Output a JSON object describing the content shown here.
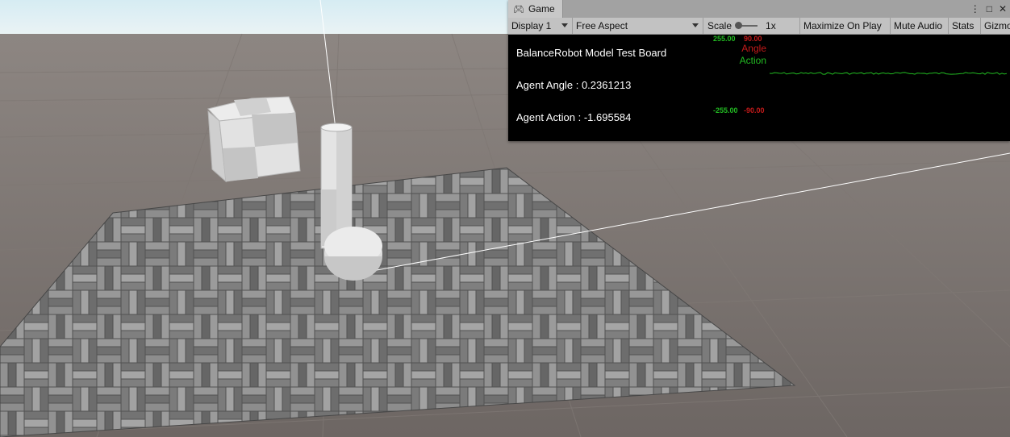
{
  "game_window": {
    "tab_title": "Game",
    "tab_icon": "gamepad-icon",
    "toolbar": {
      "display": "Display 1",
      "aspect": "Free Aspect",
      "scale_label": "Scale",
      "scale_value": "1x",
      "maximize_on_play": "Maximize On Play",
      "mute_audio": "Mute Audio",
      "stats": "Stats",
      "gizmos": "Gizmos"
    },
    "overlay": {
      "board_title": "BalanceRobot Model Test Board",
      "agent_angle": "Agent Angle : 0.2361213",
      "agent_action": "Agent Action : -1.695584"
    },
    "graph": {
      "action_max": "255.00",
      "angle_max": "90.00",
      "action_min": "-255.00",
      "angle_min": "-90.00",
      "legend_angle": "Angle",
      "legend_action": "Action",
      "angle_color": "#c41a1a",
      "action_color": "#22bb22"
    }
  }
}
